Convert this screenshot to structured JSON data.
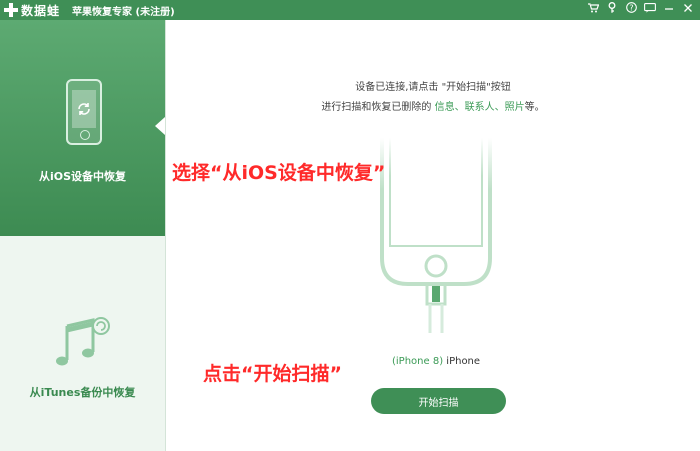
{
  "window": {
    "logo_text": "数据蛙",
    "app_title": "苹果恢复专家 (未注册)",
    "icons": [
      "cart-icon",
      "key-icon",
      "help-icon",
      "message-icon",
      "minimize-icon",
      "close-icon"
    ]
  },
  "sidebar": {
    "items": [
      {
        "label": "从iOS设备中恢复",
        "icon": "phone-sync-icon",
        "active": true
      },
      {
        "label": "从iTunes备份中恢复",
        "icon": "music-note-icon",
        "active": false
      }
    ]
  },
  "main": {
    "instruction_line1": "设备已连接,请点击 \"开始扫描\"按钮",
    "instruction_line2_prefix": "进行扫描和恢复已删除的 ",
    "instruction_items": "信息、联系人、照片",
    "instruction_line2_suffix": "等。",
    "device_model": "(iPhone 8)",
    "device_name": "iPhone",
    "scan_button": "开始扫描"
  },
  "annotations": {
    "step1": "选择“从iOS设备中恢复”",
    "step2": "点击“开始扫描”"
  },
  "colors": {
    "brand_green": "#3f8f56",
    "accent_green": "#3a9a55",
    "annotation_red": "#ff2a2a"
  }
}
